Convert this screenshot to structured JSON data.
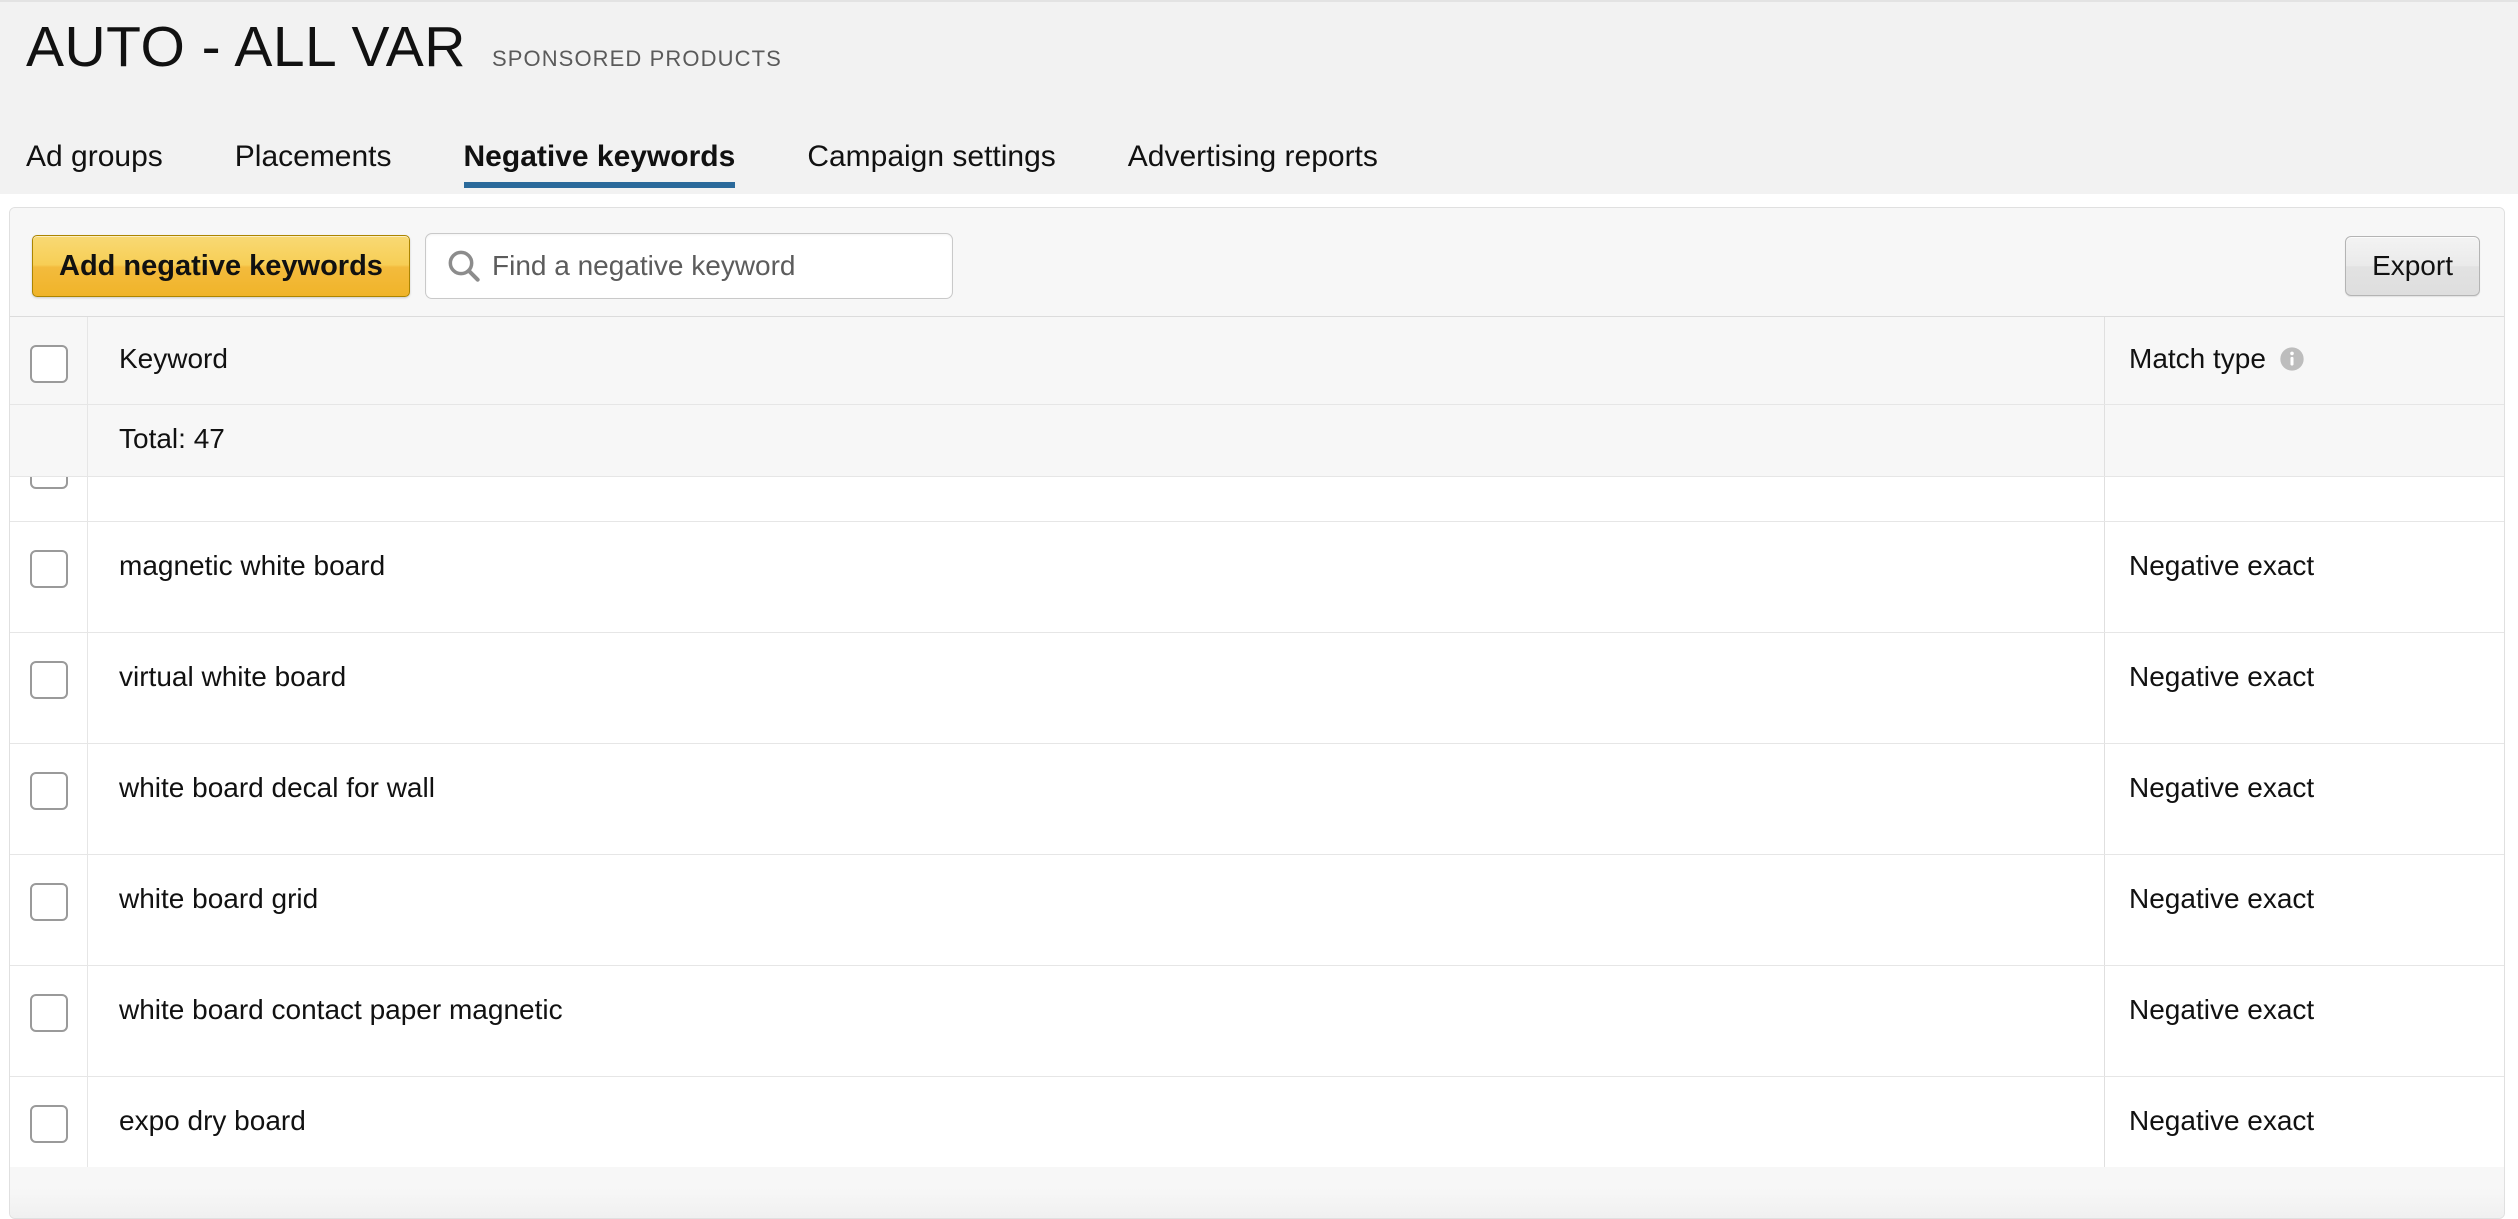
{
  "header": {
    "campaign_name": "AUTO - ALL VAR",
    "campaign_type": "SPONSORED PRODUCTS",
    "tabs": [
      {
        "label": "Ad groups",
        "active": false
      },
      {
        "label": "Placements",
        "active": false
      },
      {
        "label": "Negative keywords",
        "active": true
      },
      {
        "label": "Campaign settings",
        "active": false
      },
      {
        "label": "Advertising reports",
        "active": false
      }
    ],
    "active_tab_underline_color": "#2b6a9b"
  },
  "toolbar": {
    "add_label": "Add negative keywords",
    "add_button_color": "#f0b429",
    "search_placeholder": "Find a negative keyword",
    "search_value": "",
    "search_icon": "search-icon",
    "export_label": "Export"
  },
  "table": {
    "columns": {
      "keyword": "Keyword",
      "match_type": "Match type",
      "match_type_info_icon": "info-icon"
    },
    "total_label": "Total: 47",
    "total_count": 47,
    "rows": [
      {
        "keyword": "",
        "match_type": "",
        "clipped": true
      },
      {
        "keyword": "magnetic white board",
        "match_type": "Negative exact"
      },
      {
        "keyword": "virtual white board",
        "match_type": "Negative exact"
      },
      {
        "keyword": "white board decal for wall",
        "match_type": "Negative exact"
      },
      {
        "keyword": "white board grid",
        "match_type": "Negative exact"
      },
      {
        "keyword": "white board contact paper magnetic",
        "match_type": "Negative exact"
      },
      {
        "keyword": "expo dry board",
        "match_type": "Negative exact"
      }
    ]
  }
}
